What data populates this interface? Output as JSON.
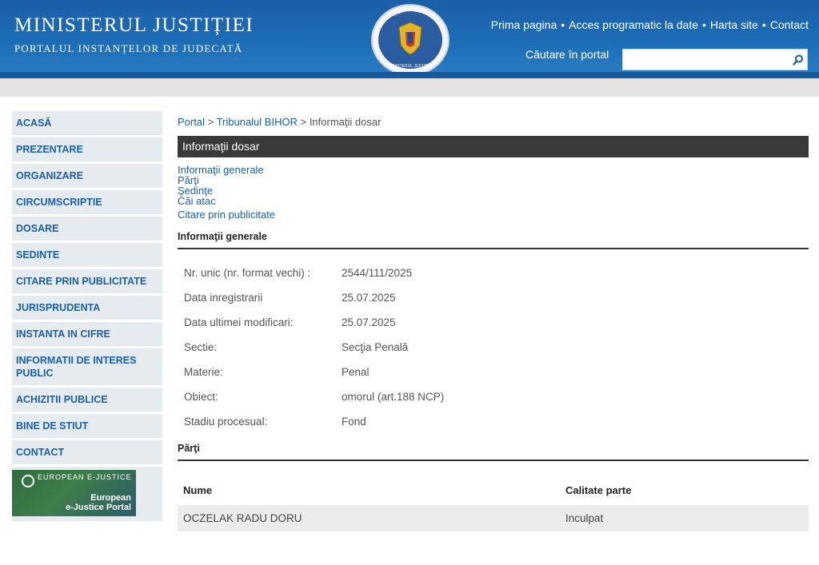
{
  "header": {
    "title": "MINISTERUL JUSTIȚIEI",
    "subtitle": "PORTALUL INSTANȚELOR DE JUDECATĂ",
    "seal_text_top": "ROMÂNIA",
    "seal_text_bottom": "MINISTERUL JUSTIȚIEI",
    "links": [
      "Prima pagina",
      "Acces programatic la date",
      "Harta site",
      "Contact"
    ],
    "search_label": "Căutare în portal",
    "search_value": ""
  },
  "sidebar": {
    "items": [
      {
        "label": "ACASĂ"
      },
      {
        "label": "PREZENTARE"
      },
      {
        "label": "ORGANIZARE"
      },
      {
        "label": "CIRCUMSCRIPTIE"
      },
      {
        "label": "DOSARE"
      },
      {
        "label": "SEDINTE"
      },
      {
        "label": "CITARE PRIN PUBLICITATE"
      },
      {
        "label": "JURISPRUDENTA"
      },
      {
        "label": "INSTANTA IN CIFRE"
      },
      {
        "label": "INFORMATII DE INTERES PUBLIC"
      },
      {
        "label": "ACHIZITII PUBLICE"
      },
      {
        "label": "BINE DE STIUT"
      },
      {
        "label": "CONTACT"
      }
    ],
    "ejustice": {
      "logo": "EUROPEAN E-JUSTICE",
      "line1": "European",
      "line2": "e-Justice Portal"
    }
  },
  "breadcrumb": {
    "portal": "Portal",
    "sep": ">",
    "court": "Tribunalul BIHOR",
    "current": "Informaţii dosar"
  },
  "page_title": "Informaţii dosar",
  "sublinks": [
    "Informaţii generale",
    "Părţi",
    "Şedinţe",
    "Căi atac",
    "Citare prin publicitate"
  ],
  "general": {
    "heading": "Informaţii generale",
    "rows": [
      {
        "label": "Nr. unic (nr. format vechi) :",
        "value": "2544/111/2025"
      },
      {
        "label": "Data inregistrarii",
        "value": "25.07.2025"
      },
      {
        "label": "Data ultimei modificari:",
        "value": "25.07.2025"
      },
      {
        "label": "Sectie:",
        "value": "Secţia Penală"
      },
      {
        "label": "Materie:",
        "value": "Penal"
      },
      {
        "label": "Obiect:",
        "value": "omorul (art.188 NCP)"
      },
      {
        "label": "Stadiu procesual:",
        "value": "Fond"
      }
    ]
  },
  "parti": {
    "heading": "Părţi",
    "columns": [
      "Nume",
      "Calitate parte"
    ],
    "rows": [
      {
        "nume": "OCZELAK RADU DORU",
        "calitate": "Inculpat"
      }
    ]
  }
}
